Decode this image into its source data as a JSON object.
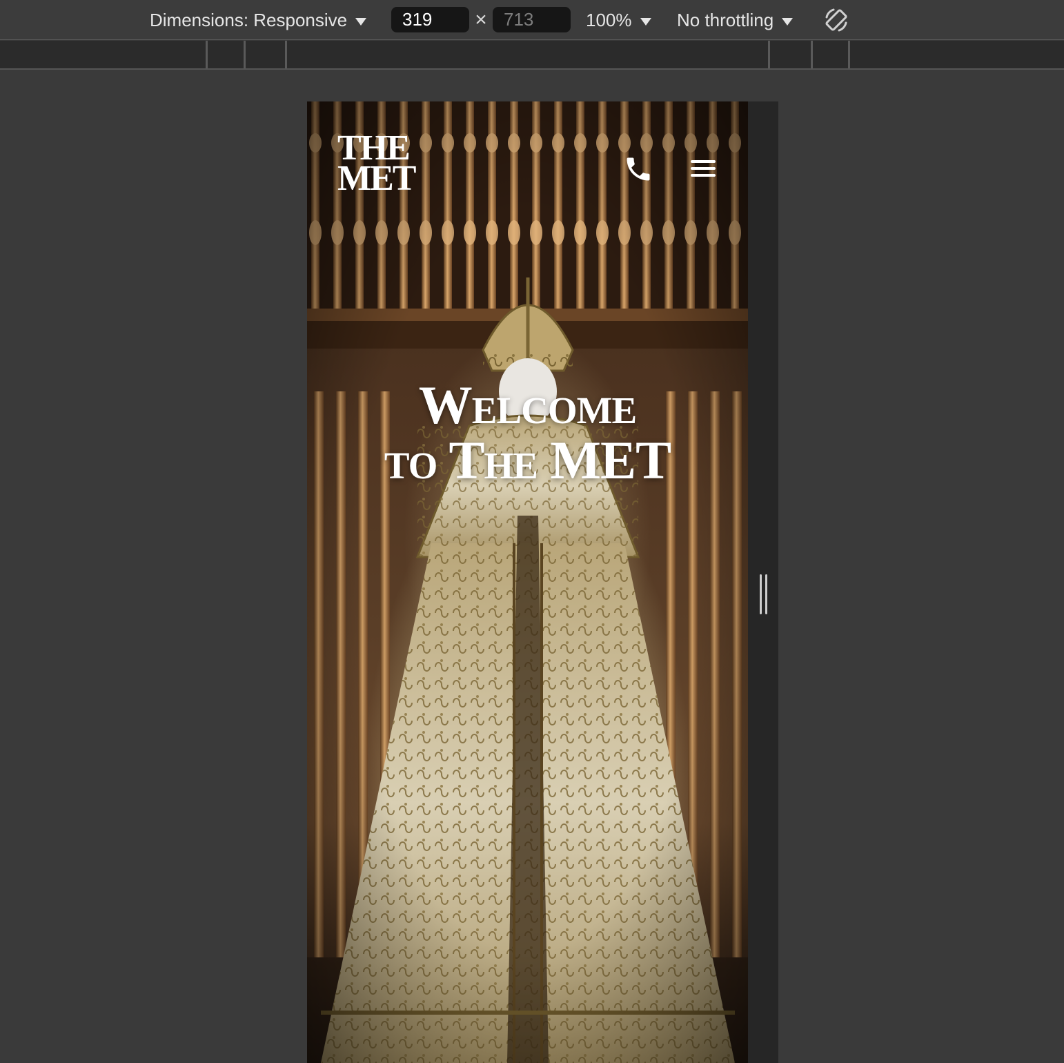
{
  "toolbar": {
    "dimensions_label": "Dimensions: Responsive",
    "width_value": "319",
    "times_glyph": "×",
    "height_value": "713",
    "zoom_label": "100%",
    "throttling_label": "No throttling",
    "rotate_icon": "rotate-icon"
  },
  "site": {
    "logo_line1": "THE",
    "logo_line2": "MET",
    "phone_icon": "phone-icon",
    "menu_icon": "hamburger-menu-icon",
    "hero_line1": "Welcome",
    "hero_line2": "to The MET"
  },
  "colors": {
    "devtools_bg": "#3a3a3a",
    "toolbar_bg": "#3c3c3c",
    "input_bg": "#161616",
    "hero_text": "#ffffff"
  }
}
